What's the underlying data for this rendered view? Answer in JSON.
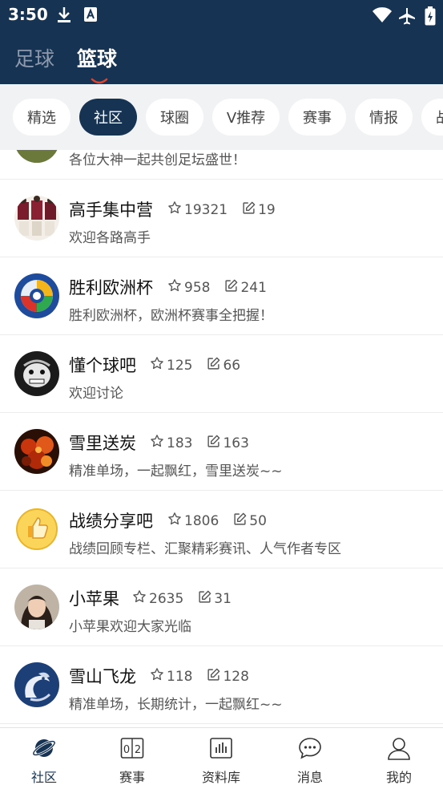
{
  "status_bar": {
    "time": "3:50"
  },
  "sport_tabs": [
    {
      "label": "足球",
      "active": false
    },
    {
      "label": "篮球",
      "active": true
    }
  ],
  "chips": [
    {
      "label": "精选"
    },
    {
      "label": "社区",
      "active": true
    },
    {
      "label": "球圈"
    },
    {
      "label": "V推荐"
    },
    {
      "label": "赛事"
    },
    {
      "label": "情报"
    },
    {
      "label": "战"
    }
  ],
  "partial_row": {
    "desc": "各位大神一起共创足坛盛世！"
  },
  "communities": [
    {
      "name": "高手集中营",
      "stars": "19321",
      "posts": "19",
      "desc": "欢迎各路高手",
      "avatar": "team-photo"
    },
    {
      "name": "胜利欧洲杯",
      "stars": "958",
      "posts": "241",
      "desc": "胜利欧洲杯，欧洲杯赛事全把握！",
      "avatar": "euro-logo"
    },
    {
      "name": "懂个球吧",
      "stars": "125",
      "posts": "66",
      "desc": "欢迎讨论",
      "avatar": "lion-mask"
    },
    {
      "name": "雪里送炭",
      "stars": "183",
      "posts": "163",
      "desc": "精准单场，一起飘红，雪里送炭~~",
      "avatar": "burning-coal"
    },
    {
      "name": "战绩分享吧",
      "stars": "1806",
      "posts": "50",
      "desc": "战绩回顾专栏、汇聚精彩赛讯、人气作者专区",
      "avatar": "thumbs-up"
    },
    {
      "name": "小苹果",
      "stars": "2635",
      "posts": "31",
      "desc": "小苹果欢迎大家光临",
      "avatar": "woman-portrait"
    },
    {
      "name": "雪山飞龙",
      "stars": "118",
      "posts": "128",
      "desc": "精准单场，长期统计，一起飘红~~",
      "avatar": "white-dragon"
    }
  ],
  "bottom_nav": [
    {
      "label": "社区",
      "icon": "planet-icon",
      "active": true
    },
    {
      "label": "赛事",
      "icon": "scoreboard-icon"
    },
    {
      "label": "资料库",
      "icon": "bar-chart-icon"
    },
    {
      "label": "消息",
      "icon": "chat-bubble-icon"
    },
    {
      "label": "我的",
      "icon": "person-icon"
    }
  ],
  "colors": {
    "primary": "#163353",
    "chip_bg": "#f1f2f4",
    "accent": "#e0442d"
  }
}
